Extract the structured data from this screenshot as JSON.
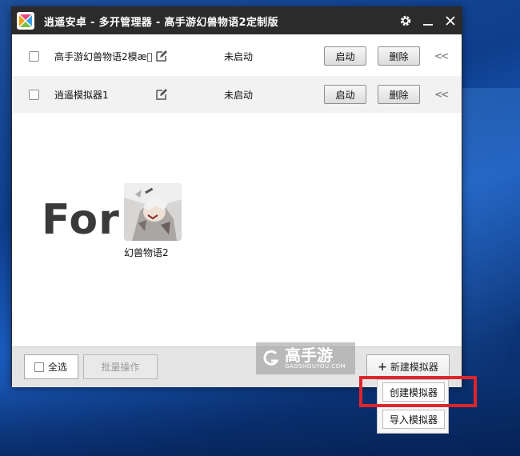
{
  "window": {
    "title": "逍遥安卓 - 多开管理器 - 高手游幻兽物语2定制版"
  },
  "emulators": [
    {
      "name": "高手游幻兽物语2模æ\u0000",
      "status": "未启动",
      "start_label": "启动",
      "delete_label": "删除",
      "collapse": "<<"
    },
    {
      "name": "逍遥模拟器1",
      "status": "未启动",
      "start_label": "启动",
      "delete_label": "删除",
      "collapse": "<<"
    }
  ],
  "overlay": {
    "for_text": "For",
    "game_name": "幻兽物语2"
  },
  "footer": {
    "select_all_label": "全选",
    "batch_label": "批量操作",
    "new_label": "新建模拟器",
    "new_icon": "+"
  },
  "watermark": {
    "brand": "高手游",
    "sub": "GAOSHOUYOU.COM"
  },
  "dropdown": {
    "items": [
      "创建模拟器",
      "导入模拟器"
    ]
  },
  "colors": {
    "titlebar": "#2b2b2b",
    "highlight": "#e0242b",
    "desktop": "#0e3e8c"
  }
}
